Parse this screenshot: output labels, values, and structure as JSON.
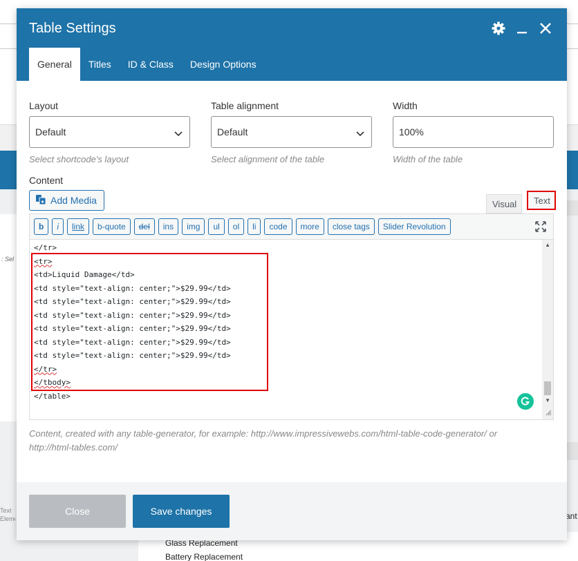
{
  "modal": {
    "title": "Table Settings",
    "tabs": [
      {
        "label": "General",
        "active": true
      },
      {
        "label": "Titles",
        "active": false
      },
      {
        "label": "ID & Class",
        "active": false
      },
      {
        "label": "Design Options",
        "active": false
      }
    ]
  },
  "fields": {
    "layout": {
      "label": "Layout",
      "value": "Default",
      "help": "Select shortcode's layout"
    },
    "alignment": {
      "label": "Table alignment",
      "value": "Default",
      "help": "Select alignment of the table"
    },
    "width": {
      "label": "Width",
      "value": "100%",
      "help": "Width of the table"
    }
  },
  "content": {
    "label": "Content",
    "add_media": "Add Media",
    "mode_visual": "Visual",
    "mode_text": "Text",
    "toolbar": [
      "b",
      "i",
      "link",
      "b-quote",
      "del",
      "ins",
      "img",
      "ul",
      "ol",
      "li",
      "code",
      "more",
      "close tags",
      "Slider Revolution"
    ],
    "code_lines": [
      "</tr>",
      "<tr>",
      "<td>Liquid Damage</td>",
      "<td style=\"text-align: center;\">$29.99</td>",
      "<td style=\"text-align: center;\">$29.99</td>",
      "<td style=\"text-align: center;\">$29.99</td>",
      "<td style=\"text-align: center;\">$29.99</td>",
      "<td style=\"text-align: center;\">$29.99</td>",
      "<td style=\"text-align: center;\">$29.99</td>",
      "</tr>",
      "</tbody>",
      "</table>"
    ],
    "help": "Content, created with any table-generator, for example: http://www.impressivewebs.com/html-table-code-generator/ or http://html-tables.com/"
  },
  "footer": {
    "close": "Close",
    "save": "Save changes"
  },
  "background": {
    "items": [
      "Glass Replacement",
      "Battery Replacement"
    ],
    "left_text": "Text Eleme",
    "sel_text": ": Sel",
    "right_text": "ant"
  },
  "colors": {
    "accent": "#1e73a8",
    "highlight": "#e00000",
    "grammarly": "#15c39a"
  }
}
